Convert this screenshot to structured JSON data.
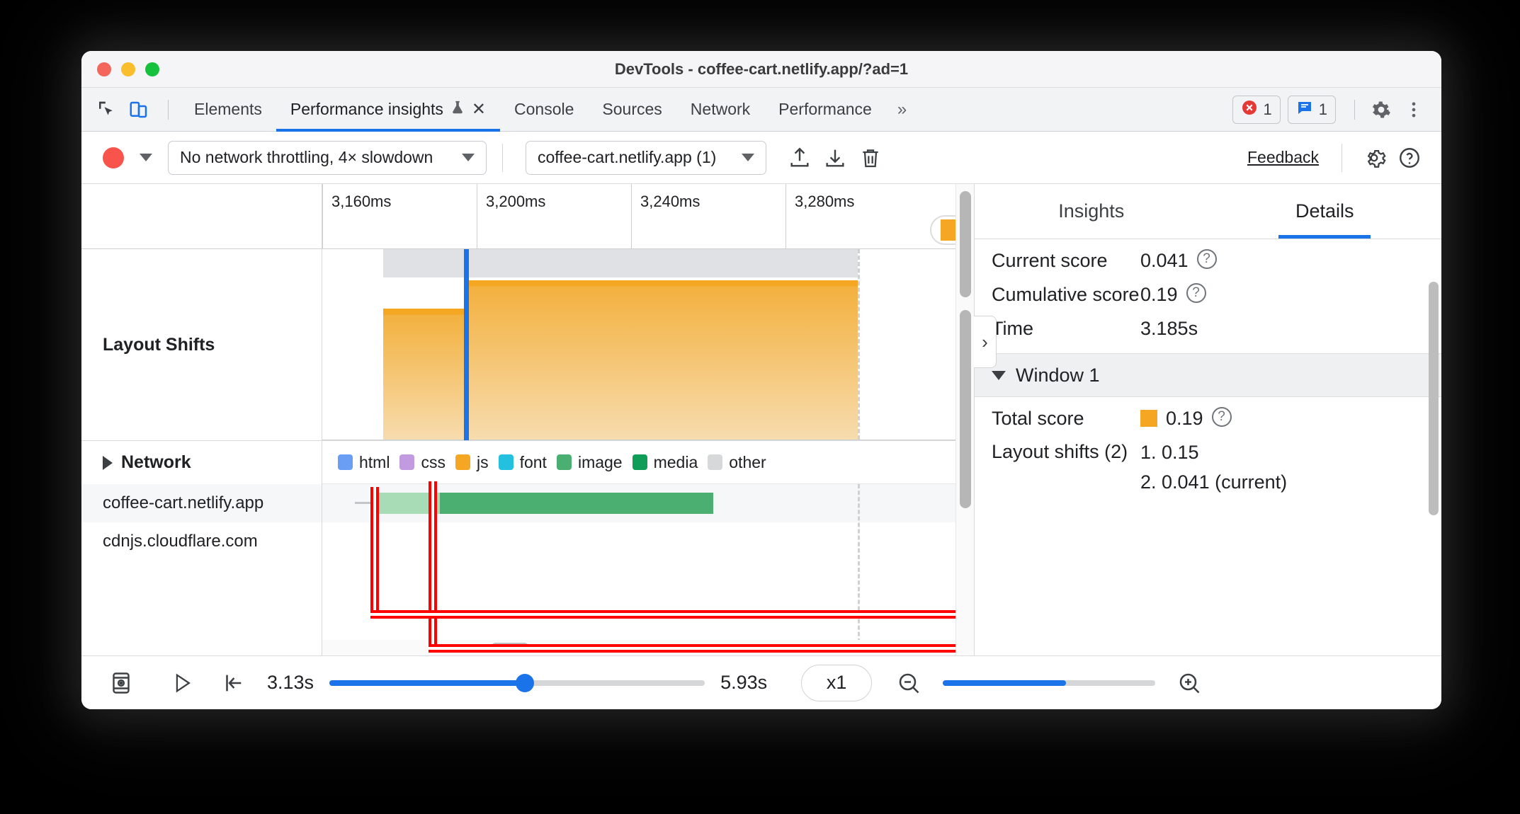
{
  "window": {
    "title": "DevTools - coffee-cart.netlify.app/?ad=1",
    "controls": {
      "close": "close",
      "minimize": "minimize",
      "zoom": "zoom"
    }
  },
  "tabbar": {
    "inspect_icon": "inspect-element-icon",
    "device_icon": "device-toolbar-icon",
    "tabs": [
      {
        "label": "Elements",
        "active": false
      },
      {
        "label": "Performance insights",
        "active": true,
        "experimental": true,
        "closable": true
      },
      {
        "label": "Console",
        "active": false
      },
      {
        "label": "Sources",
        "active": false
      },
      {
        "label": "Network",
        "active": false
      },
      {
        "label": "Performance",
        "active": false
      }
    ],
    "overflow": "»",
    "error_count": "1",
    "message_count": "1",
    "settings_icon": "gear-icon",
    "more_icon": "kebab-menu-icon"
  },
  "toolbar": {
    "record_label": "record",
    "throttling": "No network throttling, 4× slowdown",
    "page_select": "coffee-cart.netlify.app (1)",
    "upload_icon": "upload-icon",
    "download_icon": "download-icon",
    "trash_icon": "trash-icon",
    "feedback": "Feedback",
    "settings_icon": "gear-icon",
    "help_icon": "help-icon"
  },
  "timeline": {
    "ticks": [
      "3,160ms",
      "3,200ms",
      "3,240ms",
      "3,280ms"
    ],
    "tracks": [
      {
        "name": "Layout Shifts",
        "expandable": false
      },
      {
        "name": "Network",
        "expandable": true,
        "expanded": false
      }
    ],
    "requests": [
      {
        "url": "coffee-cart.netlify.app",
        "selected": true
      },
      {
        "url": "cdnjs.cloudflare.com",
        "selected": false
      }
    ],
    "legend": [
      {
        "label": "html",
        "color": "#6a9ef5"
      },
      {
        "label": "css",
        "color": "#c19ae0"
      },
      {
        "label": "js",
        "color": "#f5a623"
      },
      {
        "label": "font",
        "color": "#23c0e0"
      },
      {
        "label": "image",
        "color": "#4caf72"
      },
      {
        "label": "media",
        "color": "#0f9d58"
      },
      {
        "label": "other",
        "color": "#d6d8da"
      }
    ],
    "screenshots": [
      {
        "label": "layout-shift-screenshot-1",
        "selected": false
      },
      {
        "label": "layout-shift-screenshot-2",
        "selected": true
      }
    ]
  },
  "details": {
    "tabs": [
      {
        "label": "Insights",
        "active": false
      },
      {
        "label": "Details",
        "active": true
      }
    ],
    "rows": [
      {
        "key": "Current score",
        "value": "0.041",
        "help": true
      },
      {
        "key": "Cumulative score",
        "value": "0.19",
        "help": true
      },
      {
        "key": "Time",
        "value": "3.185s",
        "help": false
      }
    ],
    "window_section": {
      "title": "Window 1",
      "expanded": true,
      "total_score_label": "Total score",
      "total_score_value": "0.19",
      "total_score_swatch": "#f5a623",
      "shifts_label": "Layout shifts (2)",
      "shifts": [
        "1. 0.15",
        "2. 0.041 (current)"
      ]
    }
  },
  "bottombar": {
    "filmstrip_icon": "filmstrip-icon",
    "play_icon": "play-icon",
    "rewind_icon": "jump-to-start-icon",
    "start_time": "3.13s",
    "end_time": "5.93s",
    "speed": "x1",
    "zoom_out_icon": "zoom-out-icon",
    "zoom_in_icon": "zoom-in-icon"
  }
}
